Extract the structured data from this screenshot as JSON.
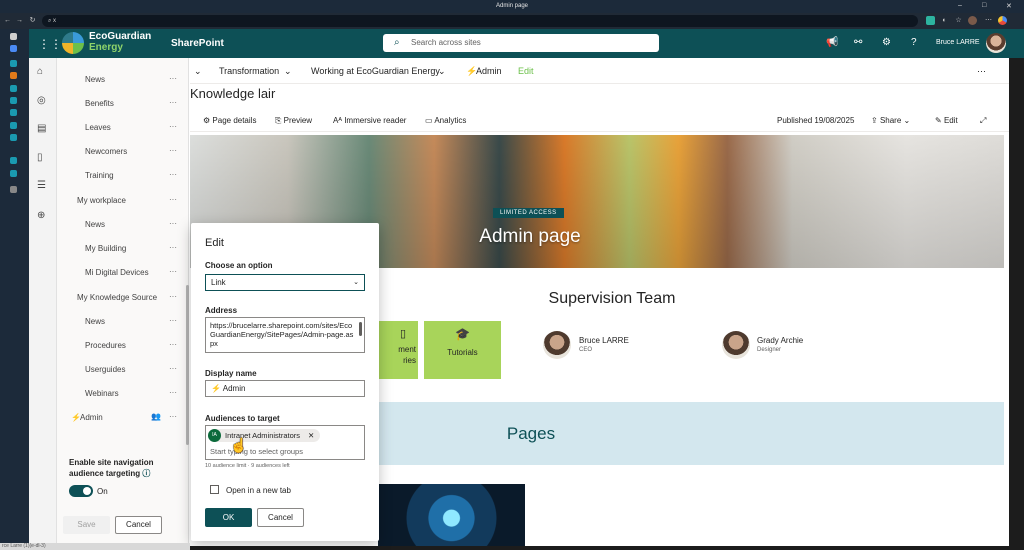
{
  "browser": {
    "tab_title": "Admin page",
    "address": "x",
    "status_text": "rce Larre (1)(e-dl-3)"
  },
  "suite": {
    "brand_line1": "EcoGuardian",
    "brand_line2": "Energy",
    "app_name": "SharePoint",
    "search_placeholder": "Search across sites",
    "user_name": "Bruce LARRE"
  },
  "left_nav": {
    "items": [
      {
        "label": "News"
      },
      {
        "label": "Benefits"
      },
      {
        "label": "Leaves"
      },
      {
        "label": "Newcomers"
      },
      {
        "label": "Training"
      },
      {
        "label": "My workplace"
      },
      {
        "label": "News"
      },
      {
        "label": "My Building"
      },
      {
        "label": "Mi Digital Devices"
      },
      {
        "label": "My Knowledge Source"
      },
      {
        "label": "News"
      },
      {
        "label": "Procedures"
      },
      {
        "label": "Userguides"
      },
      {
        "label": "Webinars"
      },
      {
        "label": "Admin"
      }
    ],
    "more": "···",
    "targeting_label": "Enable site navigation audience targeting",
    "toggle_state": "On",
    "save": "Save",
    "cancel": "Cancel"
  },
  "top_nav": {
    "items": [
      "Transformation",
      "Working at EcoGuardian Energy",
      "Admin",
      "Edit"
    ]
  },
  "page": {
    "title": "Knowledge lair",
    "toolbar": {
      "page_details": "Page details",
      "preview": "Preview",
      "immersive": "Immersive reader",
      "analytics": "Analytics",
      "published": "Published 19/08/2025",
      "share": "Share",
      "edit": "Edit"
    },
    "hero_badge": "LIMITED ACCESS",
    "hero_title": "Admin page",
    "section_title": "Supervision Team",
    "tiles": [
      {
        "label": "ment\nries"
      },
      {
        "label": "Tutorials"
      }
    ],
    "people": [
      {
        "name": "Bruce LARRE",
        "role": "CEO"
      },
      {
        "name": "Grady Archie",
        "role": "Designer"
      }
    ],
    "pages_title": "Pages"
  },
  "edit_panel": {
    "title": "Edit",
    "choose_label": "Choose an option",
    "choose_value": "Link",
    "address_label": "Address",
    "address_value": "https://brucelarre.sharepoint.com/sites/EcoGuardianEnergy/SitePages/Admin-page.aspx",
    "display_label": "Display name",
    "display_value": "Admin",
    "audience_label": "Audiences to target",
    "chip_initials": "IA",
    "chip_label": "Intranet Administrators",
    "audience_placeholder": "Start typing to select groups",
    "audience_hint": "10 audience limit · 9 audiences left",
    "new_tab_label": "Open in a new tab",
    "ok": "OK",
    "cancel": "Cancel"
  },
  "colors": {
    "brand": "#0d5056",
    "tile": "#a8d45a",
    "pages_band": "#d3e7ee"
  }
}
